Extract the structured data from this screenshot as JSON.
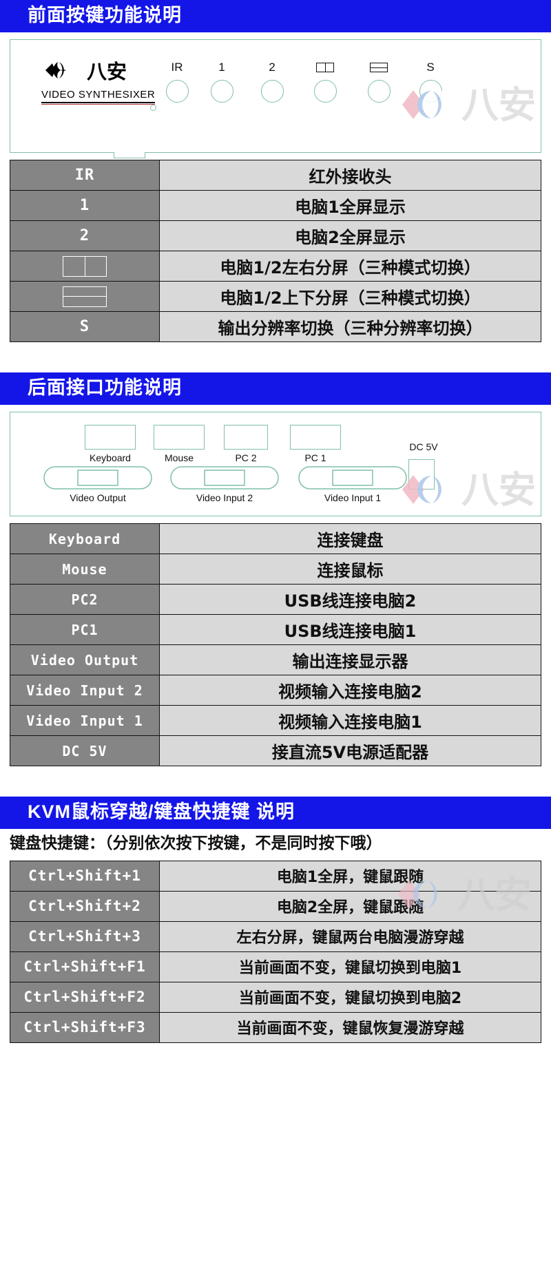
{
  "sections": {
    "front": {
      "banner": "前面按键功能说明",
      "brand": {
        "cn": "八安",
        "sub": "VIDEO  SYNTHESIXER"
      },
      "buttons": [
        {
          "label": "IR",
          "type": "text"
        },
        {
          "label": "1",
          "type": "text"
        },
        {
          "label": "2",
          "type": "text"
        },
        {
          "label": "split-horizontal-icon",
          "type": "icon"
        },
        {
          "label": "split-vertical-icon",
          "type": "icon"
        },
        {
          "label": "S",
          "type": "text"
        }
      ],
      "table": [
        {
          "key": "IR",
          "key_type": "text",
          "value": "红外接收头"
        },
        {
          "key": "1",
          "key_type": "text",
          "value": "电脑1全屏显示"
        },
        {
          "key": "2",
          "key_type": "text",
          "value": "电脑2全屏显示"
        },
        {
          "key": "split-horizontal-icon",
          "key_type": "icon-h",
          "value": "电脑1/2左右分屏（三种模式切换）"
        },
        {
          "key": "split-vertical-icon",
          "key_type": "icon-v",
          "value": "电脑1/2上下分屏（三种模式切换）"
        },
        {
          "key": "S",
          "key_type": "text",
          "value": "输出分辨率切换（三种分辨率切换）"
        }
      ]
    },
    "rear": {
      "banner": "后面接口功能说明",
      "usb_labels": [
        "Keyboard",
        "Mouse",
        "PC  2",
        "PC  1"
      ],
      "power_label": "DC 5V",
      "vga_labels": [
        "Video Output",
        "Video Input 2",
        "Video Input 1"
      ],
      "table": [
        {
          "key": "Keyboard",
          "value": "连接键盘"
        },
        {
          "key": "Mouse",
          "value": "连接鼠标"
        },
        {
          "key": "PC2",
          "value": "USB线连接电脑2"
        },
        {
          "key": "PC1",
          "value": "USB线连接电脑1"
        },
        {
          "key": "Video Output",
          "value": "输出连接显示器"
        },
        {
          "key": "Video Input 2",
          "value": "视频输入连接电脑2"
        },
        {
          "key": "Video Input 1",
          "value": "视频输入连接电脑1"
        },
        {
          "key": "DC 5V",
          "value": "接直流5V电源适配器"
        }
      ]
    },
    "kvm": {
      "banner": "KVM鼠标穿越/键盘快捷键  说明",
      "note": "键盘快捷键：（分别依次按下按键，不是同时按下哦）",
      "table": [
        {
          "key": "Ctrl+Shift+1",
          "value": "电脑1全屏，键鼠跟随"
        },
        {
          "key": "Ctrl+Shift+2",
          "value": "电脑2全屏，键鼠跟随"
        },
        {
          "key": "Ctrl+Shift+3",
          "value": "左右分屏，键鼠两台电脑漫游穿越"
        },
        {
          "key": "Ctrl+Shift+F1",
          "value": "当前画面不变，键鼠切换到电脑1"
        },
        {
          "key": "Ctrl+Shift+F2",
          "value": "当前画面不变，键鼠切换到电脑2"
        },
        {
          "key": "Ctrl+Shift+F3",
          "value": "当前画面不变，键鼠恢复漫游穿越"
        }
      ]
    }
  },
  "watermark": {
    "text": "八安"
  },
  "colors": {
    "banner_blue": "#1416e8",
    "key_gray": "#858585",
    "value_gray": "#d9d9d9",
    "panel_outline": "#7fbfa8"
  }
}
